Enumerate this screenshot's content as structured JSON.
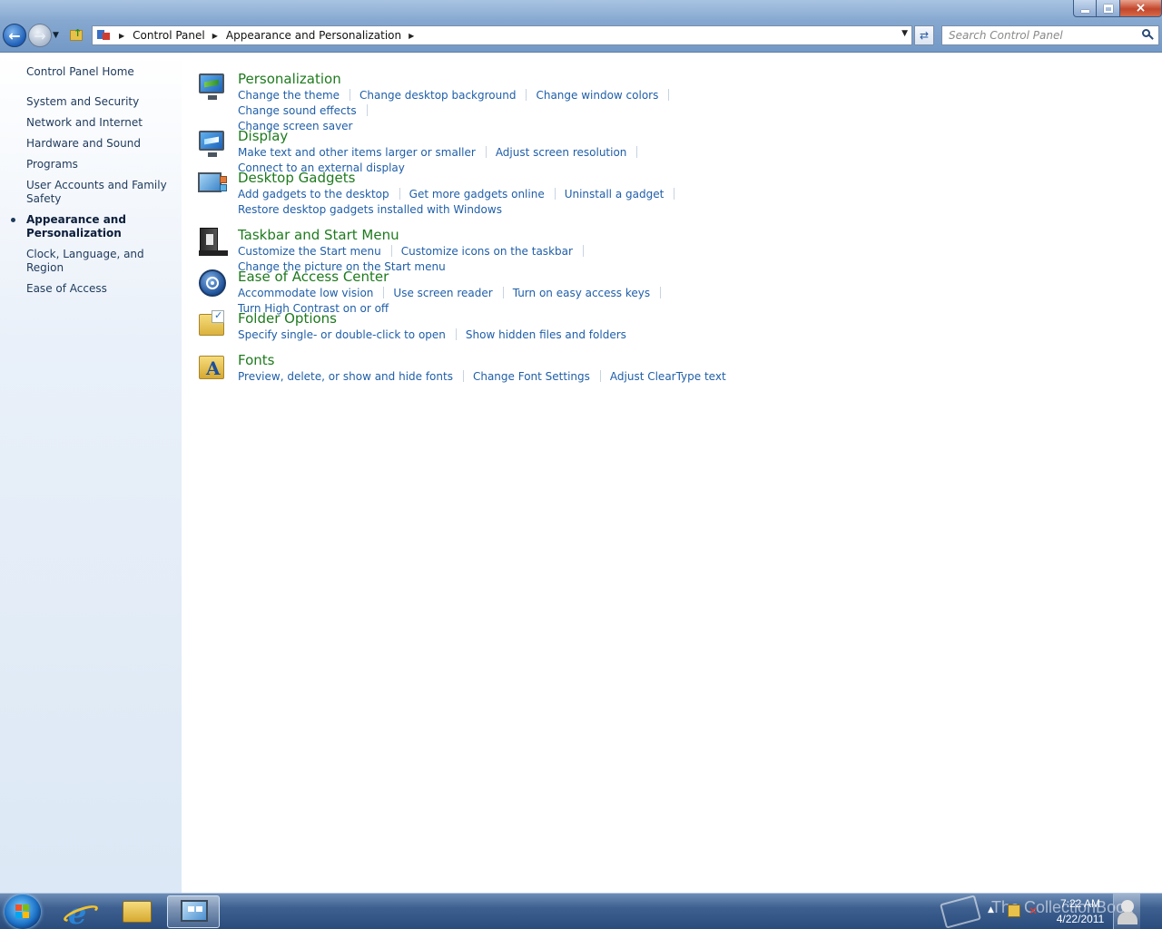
{
  "window": {
    "caption_buttons": {
      "minimize": "minimize",
      "maximize": "maximize",
      "close": "×"
    }
  },
  "address_bar": {
    "crumbs": [
      "Control Panel",
      "Appearance and Personalization"
    ]
  },
  "search": {
    "placeholder": "Search Control Panel"
  },
  "sidebar": {
    "home": "Control Panel Home",
    "items": [
      {
        "label": "System and Security",
        "active": false
      },
      {
        "label": "Network and Internet",
        "active": false
      },
      {
        "label": "Hardware and Sound",
        "active": false
      },
      {
        "label": "Programs",
        "active": false
      },
      {
        "label": "User Accounts and Family Safety",
        "active": false
      },
      {
        "label": "Appearance and Personalization",
        "active": true
      },
      {
        "label": "Clock, Language, and Region",
        "active": false
      },
      {
        "label": "Ease of Access",
        "active": false
      }
    ]
  },
  "categories": [
    {
      "title": "Personalization",
      "icon": "personalization-icon",
      "links": [
        "Change the theme",
        "Change desktop background",
        "Change window colors",
        "Change sound effects",
        "Change screen saver"
      ]
    },
    {
      "title": "Display",
      "icon": "display-icon",
      "links": [
        "Make text and other items larger or smaller",
        "Adjust screen resolution",
        "Connect to an external display"
      ]
    },
    {
      "title": "Desktop Gadgets",
      "icon": "desktop-gadgets-icon",
      "links": [
        "Add gadgets to the desktop",
        "Get more gadgets online",
        "Uninstall a gadget",
        "Restore desktop gadgets installed with Windows"
      ]
    },
    {
      "title": "Taskbar and Start Menu",
      "icon": "taskbar-icon",
      "links": [
        "Customize the Start menu",
        "Customize icons on the taskbar",
        "Change the picture on the Start menu"
      ]
    },
    {
      "title": "Ease of Access Center",
      "icon": "ease-of-access-icon",
      "links": [
        "Accommodate low vision",
        "Use screen reader",
        "Turn on easy access keys",
        "Turn High Contrast on or off"
      ]
    },
    {
      "title": "Folder Options",
      "icon": "folder-options-icon",
      "links": [
        "Specify single- or double-click to open",
        "Show hidden files and folders"
      ]
    },
    {
      "title": "Fonts",
      "icon": "fonts-icon",
      "links": [
        "Preview, delete, or show and hide fonts",
        "Change Font Settings",
        "Adjust ClearType text"
      ]
    }
  ],
  "taskbar": {
    "pinned": [
      "internet-explorer-icon",
      "windows-explorer-icon",
      "control-panel-icon"
    ],
    "tray": {
      "time": "7:22 AM",
      "date": "4/22/2011",
      "watermark": "The CollectionBook"
    }
  },
  "colors": {
    "category_title": "#1e7a1e",
    "link": "#1f5ea8",
    "sidebar_text": "#1e395b"
  }
}
